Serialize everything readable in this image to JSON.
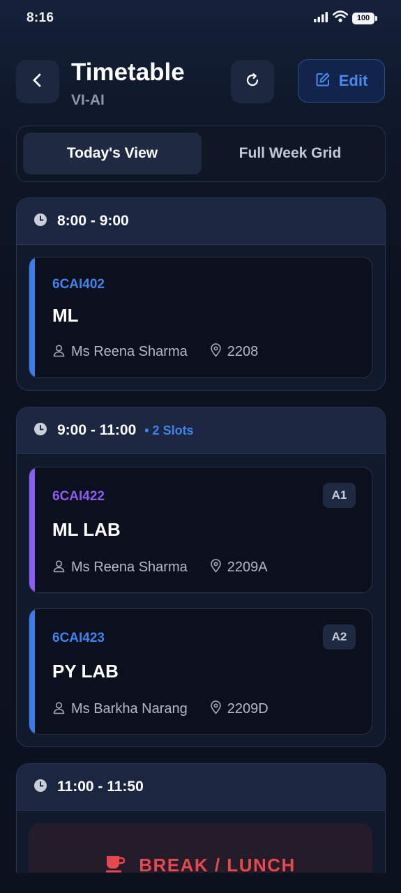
{
  "status_bar": {
    "time": "8:16",
    "battery": "100",
    "icons": [
      "signal-icon",
      "wifi-icon",
      "battery-icon"
    ]
  },
  "header": {
    "title": "Timetable",
    "subtitle": "VI-AI",
    "edit_label": "Edit",
    "icons": [
      "back-icon",
      "refresh-icon",
      "edit-icon"
    ]
  },
  "tabs": [
    {
      "label": "Today's View",
      "active": true
    },
    {
      "label": "Full Week Grid",
      "active": false
    }
  ],
  "slots": [
    {
      "time": "8:00 - 9:00",
      "count": "",
      "classes": [
        {
          "code": "6CAI402",
          "name": "ML",
          "teacher": "Ms Reena Sharma",
          "room": "2208",
          "tag": "",
          "accent": "#3f7be8"
        }
      ]
    },
    {
      "time": "9:00 - 11:00",
      "count": "• 2 Slots",
      "classes": [
        {
          "code": "6CAI422",
          "name": "ML LAB",
          "teacher": "Ms Reena Sharma",
          "room": "2209A",
          "tag": "A1",
          "accent": "#8b5cf6"
        },
        {
          "code": "6CAI423",
          "name": "PY LAB",
          "teacher": "Ms Barkha Narang",
          "room": "2209D",
          "tag": "A2",
          "accent": "#3f7be8"
        }
      ]
    },
    {
      "time": "11:00 - 11:50",
      "count": "",
      "break_label": "BREAK / LUNCH"
    }
  ],
  "colors": {
    "accent_blue": "#3f84ea",
    "accent_purple": "#8b5cf6",
    "break_red": "#e5484d"
  }
}
